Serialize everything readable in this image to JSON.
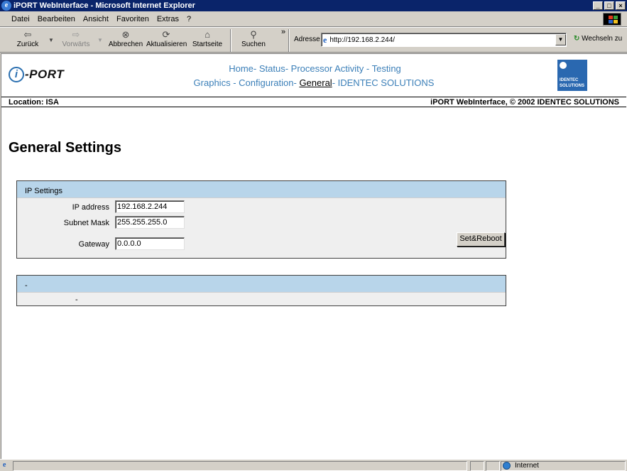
{
  "window": {
    "title": "iPORT WebInterface - Microsoft Internet Explorer",
    "controls": {
      "minimize": "_",
      "maximize": "□",
      "close": "×"
    }
  },
  "menu": [
    "Datei",
    "Bearbeiten",
    "Ansicht",
    "Favoriten",
    "Extras",
    "?"
  ],
  "toolbar": {
    "back": "Zurück",
    "forward": "Vorwärts",
    "stop": "Abbrechen",
    "refresh": "Aktualisieren",
    "home": "Startseite",
    "search": "Suchen",
    "overflow": "»",
    "address_label": "Adresse",
    "address_value": "http://192.168.2.244/",
    "go_label": "Wechseln zu"
  },
  "header": {
    "logo_letter": "i",
    "logo_text": "-PORT",
    "nav_row1": [
      "Home",
      "Status",
      "Processor Activity",
      "Testing"
    ],
    "nav_row2": [
      "Graphics",
      "Configuration",
      "General",
      "IDENTEC SOLUTIONS"
    ],
    "nav_separator": "- ",
    "current_page": "General",
    "brand_line1": "IDENTEC",
    "brand_line2": "SOLUTIONS"
  },
  "location_bar": {
    "left": "Location: ISA",
    "right": "iPORT WebInterface, © 2002 IDENTEC SOLUTIONS"
  },
  "page_title": "General Settings",
  "ip_settings": {
    "title": "IP Settings",
    "ip_label": "IP address",
    "ip_value": "192.168.2.244",
    "mask_label": "Subnet Mask",
    "mask_value": "255.255.255.0",
    "gateway_label": "Gateway",
    "gateway_value": "0.0.0.0",
    "button_label": "Set&Reboot"
  },
  "second_box": {
    "title": "-",
    "cell": "-"
  },
  "status_bar": {
    "zone": "Internet"
  }
}
